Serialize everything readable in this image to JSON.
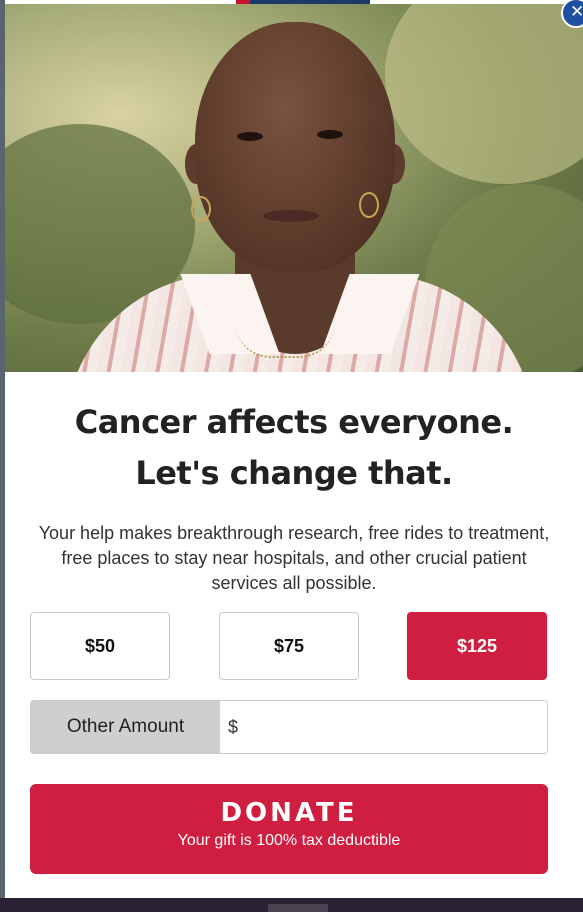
{
  "modal": {
    "close_symbol": "✕",
    "heading_line1": "Cancer affects everyone.",
    "heading_line2": "Let's change that.",
    "description": "Your help makes breakthrough research, free rides to treatment, free places to stay near hospitals, and other crucial patient services all possible.",
    "amounts": [
      {
        "label": "$50",
        "selected": false
      },
      {
        "label": "$75",
        "selected": false
      },
      {
        "label": "$125",
        "selected": true
      }
    ],
    "other_amount": {
      "label": "Other Amount",
      "currency": "$",
      "value": ""
    },
    "donate": {
      "label": "DONATE",
      "sublabel": "Your gift is 100% tax deductible"
    }
  },
  "colors": {
    "accent_red": "#d01e40",
    "close_blue": "#1f4fa0"
  },
  "icons": {
    "close": "close-icon"
  }
}
